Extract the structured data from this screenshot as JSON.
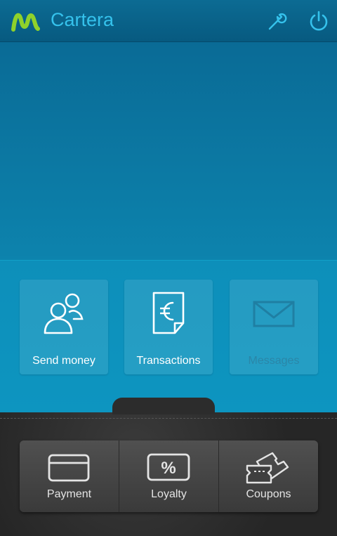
{
  "header": {
    "title": "Cartera"
  },
  "tiles": [
    {
      "label": "Send money"
    },
    {
      "label": "Transactions"
    },
    {
      "label": "Messages"
    }
  ],
  "bottom_bar": [
    {
      "label": "Payment"
    },
    {
      "label": "Loyalty"
    },
    {
      "label": "Coupons"
    }
  ],
  "colors": {
    "accent": "#35c2ec",
    "brand_green": "#8fd12b",
    "header_bg": "#0a6590",
    "menu_bg": "#0d90bb"
  }
}
